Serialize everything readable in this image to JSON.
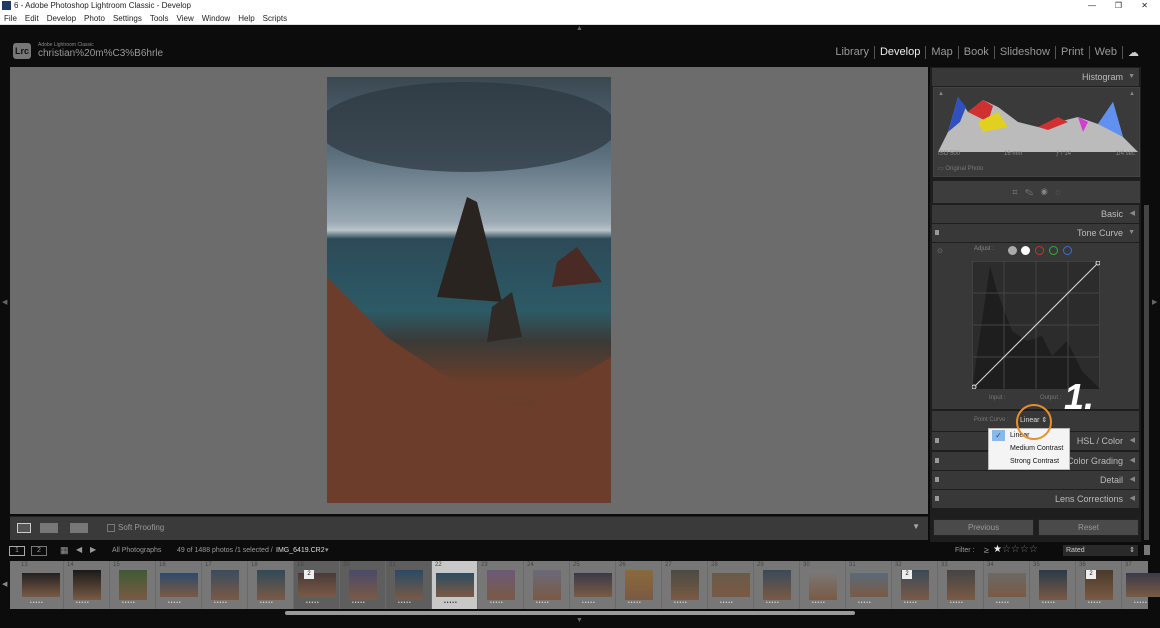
{
  "window": {
    "title": "6 - Adobe Photoshop Lightroom Classic - Develop",
    "controls": [
      "minimize",
      "maximize",
      "close"
    ]
  },
  "menu": [
    "File",
    "Edit",
    "Develop",
    "Photo",
    "Settings",
    "Tools",
    "View",
    "Window",
    "Help",
    "Scripts"
  ],
  "identity": {
    "logo": "Lrc",
    "app": "Adobe Lightroom Classic",
    "user": "christian%20m%C3%B6hrle"
  },
  "modules": [
    {
      "label": "Library"
    },
    {
      "label": "Develop",
      "active": true
    },
    {
      "label": "Map"
    },
    {
      "label": "Book"
    },
    {
      "label": "Slideshow"
    },
    {
      "label": "Print"
    },
    {
      "label": "Web"
    }
  ],
  "right_panel": {
    "histogram": {
      "title": "Histogram",
      "iso": "ISO 500",
      "focal": "16 mm",
      "aperture": "ƒ / 14",
      "shutter": "1/4 sec",
      "original_photo": "Original Photo"
    },
    "tools": [
      "crop-icon",
      "healing-icon",
      "red-eye-icon",
      "masking-icon"
    ],
    "panels": {
      "basic": "Basic",
      "tone_curve": "Tone Curve",
      "color": "HSL / Color",
      "color_grading": "Color Grading",
      "detail": "Detail",
      "lens": "Lens Corrections"
    },
    "tone_curve": {
      "adjust_label": "Adjust :",
      "channels": [
        "parametric",
        "rgb",
        "red",
        "green",
        "blue"
      ],
      "channel_colors": [
        "#cccccc",
        "#ffffff",
        "#d03030",
        "#30b030",
        "#3070e0"
      ],
      "input_label": "Input :",
      "output_label": "Output :",
      "point_curve_label": "Point Curve :",
      "point_curve_value": "Linear"
    },
    "dropdown": {
      "options": [
        "Linear",
        "Medium Contrast",
        "Strong Contrast"
      ],
      "selected": "Linear"
    },
    "previous": "Previous",
    "reset": "Reset"
  },
  "annotation": {
    "text": "1.",
    "highlight_color": "#e8902a"
  },
  "toolbar": {
    "soft_proofing": "Soft Proofing"
  },
  "filmstrip_bar": {
    "source": "All Photographs",
    "count": "49 of 1488 photos /1 selected /",
    "filename": "IMG_6419.CR2",
    "filter_label": "Filter :",
    "filter_op": "≥",
    "filter_stars": 1,
    "filter_value": "Rated",
    "monitors": [
      "1",
      "2"
    ]
  },
  "filmstrip": {
    "frames": [
      13,
      14,
      15,
      16,
      17,
      18,
      19,
      20,
      21,
      22,
      23,
      24,
      25,
      26,
      27,
      28,
      29,
      30,
      31,
      32,
      33,
      34,
      35,
      36,
      37
    ],
    "selected": 22,
    "stack_badges": {
      "19": "2",
      "32": "2",
      "36": "2"
    },
    "rating_dots": "•••••"
  }
}
